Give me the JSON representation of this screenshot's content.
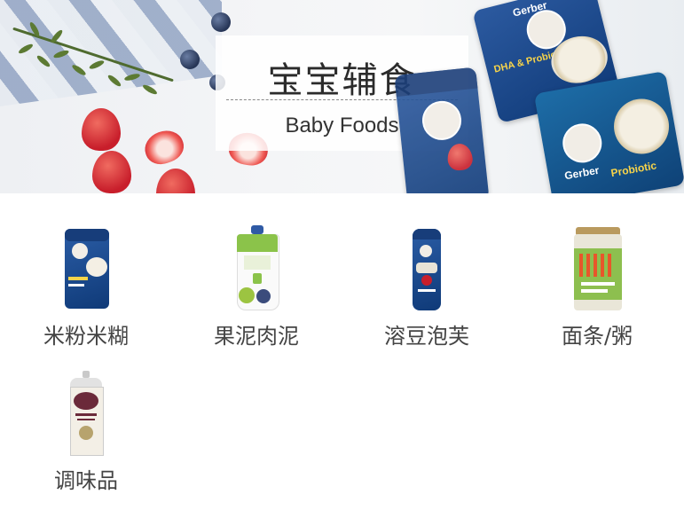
{
  "banner": {
    "title_cn": "宝宝辅食",
    "title_en": "Baby Foods",
    "pack_brand": "Gerber",
    "pack_text_1": "DHA & Probiotic",
    "pack_text_2": "Probiotic"
  },
  "categories": [
    {
      "label": "米粉米糊",
      "icon": "cereal-canister-icon"
    },
    {
      "label": "果泥肉泥",
      "icon": "puree-pouch-icon"
    },
    {
      "label": "溶豆泡芙",
      "icon": "puffs-canister-icon"
    },
    {
      "label": "面条/粥",
      "icon": "noodles-jar-icon"
    },
    {
      "label": "调味品",
      "icon": "oil-tin-icon"
    }
  ],
  "colors": {
    "gerber_blue": "#1c3f7a",
    "pouch_green": "#8bc34a",
    "label_text": "#444444"
  }
}
